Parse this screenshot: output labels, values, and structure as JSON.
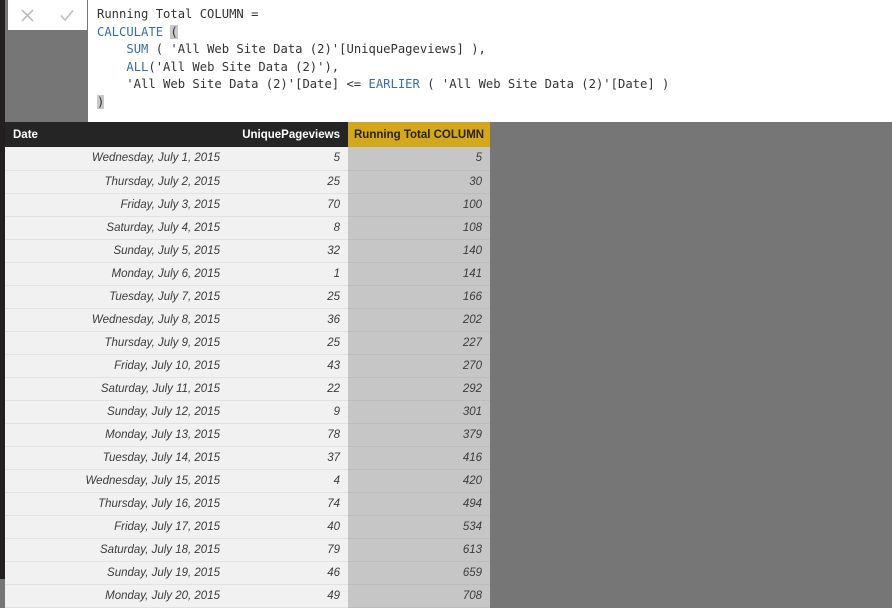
{
  "formula_bar": {
    "cancel_icon": "close-icon",
    "accept_icon": "check-icon",
    "lines": [
      [
        {
          "t": "Running Total COLUMN =",
          "c": "plain"
        }
      ],
      [
        {
          "t": "CALCULATE ",
          "c": "fn"
        },
        {
          "t": "(",
          "c": "paren-hl"
        }
      ],
      [
        {
          "t": "    ",
          "c": "plain"
        },
        {
          "t": "SUM",
          "c": "fn"
        },
        {
          "t": " ( 'All Web Site Data (2)'[UniquePageviews] ),",
          "c": "plain"
        }
      ],
      [
        {
          "t": "    ",
          "c": "plain"
        },
        {
          "t": "ALL",
          "c": "fn"
        },
        {
          "t": "('All Web Site Data (2)'),",
          "c": "plain"
        }
      ],
      [
        {
          "t": "    'All Web Site Data (2)'[Date] <= ",
          "c": "plain"
        },
        {
          "t": "EARLIER",
          "c": "fn"
        },
        {
          "t": " ( 'All Web Site Data (2)'[Date] )",
          "c": "plain"
        }
      ],
      [
        {
          "t": ")",
          "c": "paren-hl"
        }
      ]
    ]
  },
  "table": {
    "columns": [
      {
        "key": "date",
        "label": "Date",
        "align": "left"
      },
      {
        "key": "upv",
        "label": "UniquePageviews",
        "align": "right"
      },
      {
        "key": "rt",
        "label": "Running Total COLUMN",
        "align": "left",
        "highlight": "#d4a81c"
      }
    ],
    "rows": [
      {
        "date": "Wednesday, July 1, 2015",
        "upv": "5",
        "rt": "5"
      },
      {
        "date": "Thursday, July 2, 2015",
        "upv": "25",
        "rt": "30"
      },
      {
        "date": "Friday, July 3, 2015",
        "upv": "70",
        "rt": "100"
      },
      {
        "date": "Saturday, July 4, 2015",
        "upv": "8",
        "rt": "108"
      },
      {
        "date": "Sunday, July 5, 2015",
        "upv": "32",
        "rt": "140"
      },
      {
        "date": "Monday, July 6, 2015",
        "upv": "1",
        "rt": "141"
      },
      {
        "date": "Tuesday, July 7, 2015",
        "upv": "25",
        "rt": "166"
      },
      {
        "date": "Wednesday, July 8, 2015",
        "upv": "36",
        "rt": "202"
      },
      {
        "date": "Thursday, July 9, 2015",
        "upv": "25",
        "rt": "227"
      },
      {
        "date": "Friday, July 10, 2015",
        "upv": "43",
        "rt": "270"
      },
      {
        "date": "Saturday, July 11, 2015",
        "upv": "22",
        "rt": "292"
      },
      {
        "date": "Sunday, July 12, 2015",
        "upv": "9",
        "rt": "301"
      },
      {
        "date": "Monday, July 13, 2015",
        "upv": "78",
        "rt": "379"
      },
      {
        "date": "Tuesday, July 14, 2015",
        "upv": "37",
        "rt": "416"
      },
      {
        "date": "Wednesday, July 15, 2015",
        "upv": "4",
        "rt": "420"
      },
      {
        "date": "Thursday, July 16, 2015",
        "upv": "74",
        "rt": "494"
      },
      {
        "date": "Friday, July 17, 2015",
        "upv": "40",
        "rt": "534"
      },
      {
        "date": "Saturday, July 18, 2015",
        "upv": "79",
        "rt": "613"
      },
      {
        "date": "Sunday, July 19, 2015",
        "upv": "46",
        "rt": "659"
      },
      {
        "date": "Monday, July 20, 2015",
        "upv": "49",
        "rt": "708"
      }
    ]
  },
  "colors": {
    "background": "#767676",
    "rail": "#231f20",
    "header_bg": "#252526",
    "accent_gold": "#d4a81c",
    "editor_bg": "#ffffff",
    "keyword_blue": "#3a6ea5",
    "row_bg": "#f1f1f1",
    "measure_col_bg": "#c6c6c6"
  }
}
